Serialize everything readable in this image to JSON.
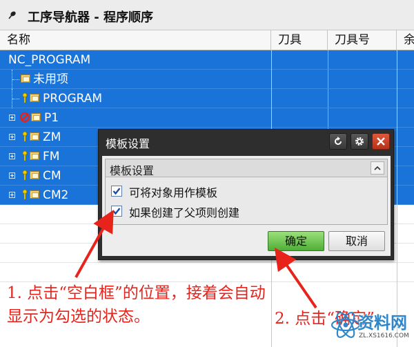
{
  "window": {
    "title": "工序导航器 - 程序顺序"
  },
  "table": {
    "columns": [
      "名称",
      "刀具",
      "刀具号",
      "余"
    ],
    "rows": [
      {
        "name": "NC_PROGRAM",
        "icon": "none"
      },
      {
        "name": "未用项",
        "icon": "folder-icon"
      },
      {
        "name": "PROGRAM",
        "icon": "key-folder-icon"
      },
      {
        "name": "P1",
        "icon": "stop-folder-icon"
      },
      {
        "name": "ZM",
        "icon": "key-folder-icon"
      },
      {
        "name": "FM",
        "icon": "key-folder-icon"
      },
      {
        "name": "CM",
        "icon": "key-folder-icon"
      },
      {
        "name": "CM2",
        "icon": "key-folder-icon"
      }
    ]
  },
  "dialog": {
    "title": "模板设置",
    "group_title": "模板设置",
    "options": [
      {
        "label": "可将对象用作模板",
        "checked": true
      },
      {
        "label": "如果创建了父项则创建",
        "checked": true
      }
    ],
    "ok_label": "确定",
    "cancel_label": "取消"
  },
  "annotations": {
    "note1": "1. 点击“空白框”的位置，接着会自动显示为勾选的状态。",
    "note2": "2. 点击“确定”"
  },
  "watermark": {
    "text": "资料网",
    "url": "ZL.XS1616.COM"
  },
  "colors": {
    "selection": "#1a73d9",
    "annotation": "#e8231c",
    "ok_button": "#5cb840",
    "close_button": "#c9401f"
  }
}
